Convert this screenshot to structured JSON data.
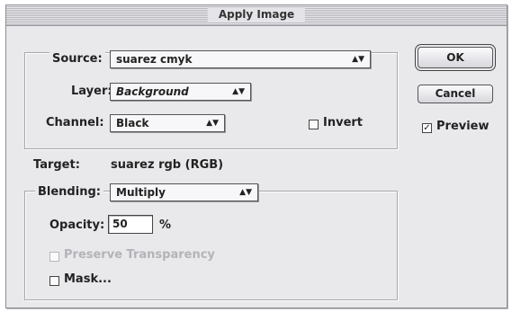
{
  "window": {
    "title": "Apply Image"
  },
  "source": {
    "label": "Source:",
    "value": "suarez cmyk",
    "layer_label": "Layer:",
    "layer_value": "Background",
    "channel_label": "Channel:",
    "channel_value": "Black",
    "invert_label": "Invert",
    "invert_checked": false
  },
  "target": {
    "label": "Target:",
    "value": "suarez rgb (RGB)"
  },
  "blending": {
    "label": "Blending:",
    "value": "Multiply",
    "opacity_label": "Opacity:",
    "opacity_value": "50",
    "opacity_unit": "%",
    "preserve_label": "Preserve Transparency",
    "preserve_checked": false,
    "preserve_enabled": false,
    "mask_label": "Mask...",
    "mask_checked": false
  },
  "buttons": {
    "ok": "OK",
    "cancel": "Cancel"
  },
  "preview": {
    "label": "Preview",
    "checked": true
  },
  "icons": {
    "popup_arrows": "up-down-arrows",
    "check_mark": "checkmark"
  }
}
